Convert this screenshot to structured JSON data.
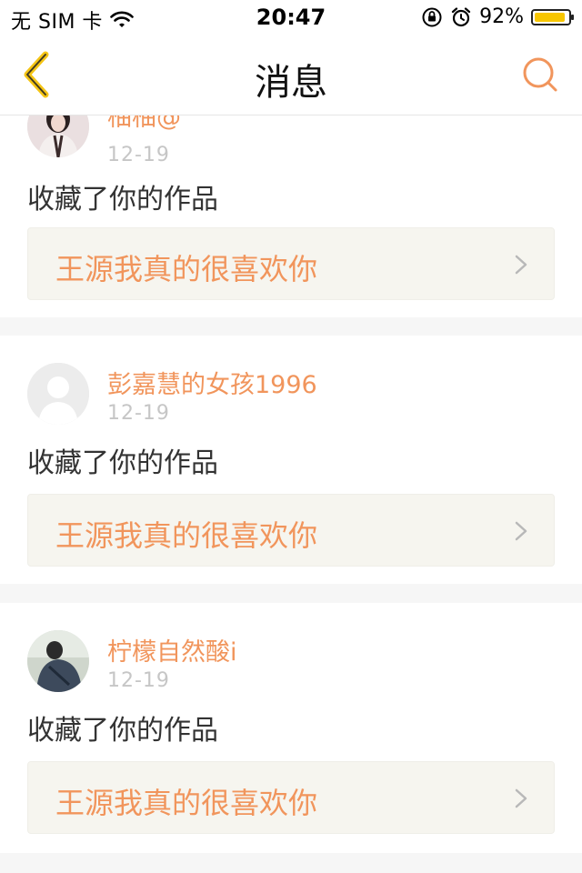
{
  "status_bar": {
    "carrier": "无 SIM 卡",
    "time": "20:47",
    "battery": "92%",
    "battery_level": 0.92
  },
  "nav": {
    "title": "消息"
  },
  "messages": [
    {
      "user": "柚柚@",
      "date": "12-19",
      "action": "收藏了你的作品",
      "work_title": "王源我真的很喜欢你"
    },
    {
      "user": "彭嘉慧的女孩1996",
      "date": "12-19",
      "action": "收藏了你的作品",
      "work_title": "王源我真的很喜欢你"
    },
    {
      "user": "柠檬自然酸i",
      "date": "12-19",
      "action": "收藏了你的作品",
      "work_title": "王源我真的很喜欢你"
    }
  ],
  "colors": {
    "accent": "#f1955c",
    "back_arrow": "#f5c516",
    "battery": "#f7c600"
  }
}
